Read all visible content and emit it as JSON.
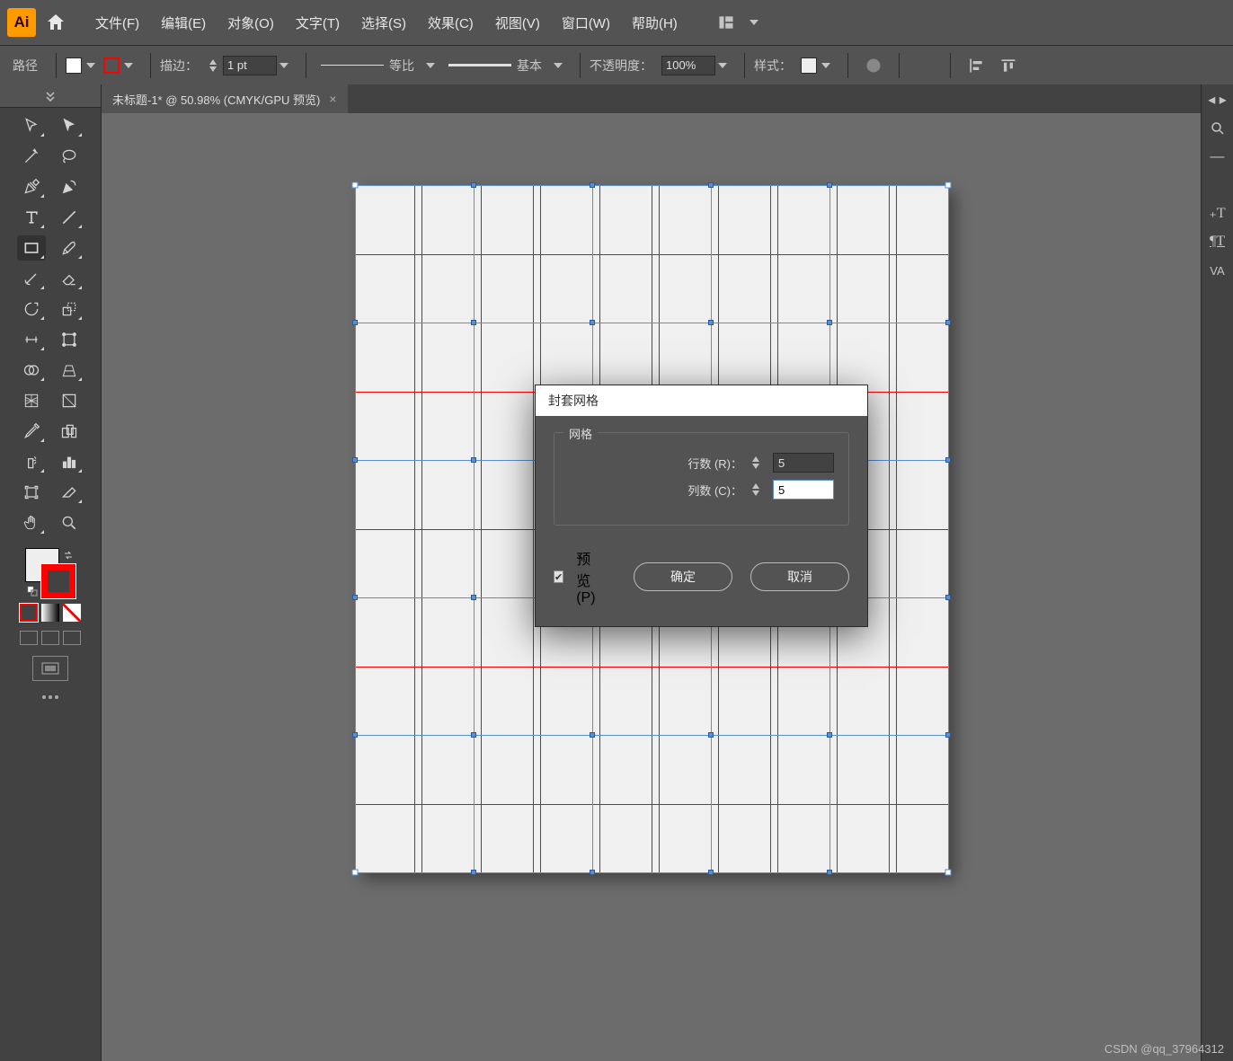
{
  "app": {
    "logo": "Ai"
  },
  "menu": {
    "file": "文件(F)",
    "edit": "编辑(E)",
    "object": "对象(O)",
    "type": "文字(T)",
    "select": "选择(S)",
    "effect": "效果(C)",
    "view": "视图(V)",
    "window": "窗口(W)",
    "help": "帮助(H)"
  },
  "control": {
    "context": "路径",
    "stroke_label": "描边：",
    "stroke_value": "1 pt",
    "profile_label": "等比",
    "brush_label": "基本",
    "opacity_label": "不透明度：",
    "opacity_value": "100%",
    "style_label": "样式："
  },
  "doc_tab": {
    "title": "未标题-1* @ 50.98% (CMYK/GPU 预览)"
  },
  "dialog": {
    "title": "封套网格",
    "group": "网格",
    "rows_label": "行数 (R)：",
    "rows_value": "5",
    "cols_label": "列数 (C)：",
    "cols_value": "5",
    "preview": "预览 (P)",
    "ok": "确定",
    "cancel": "取消"
  },
  "watermark": "CSDN @qq_37964312"
}
